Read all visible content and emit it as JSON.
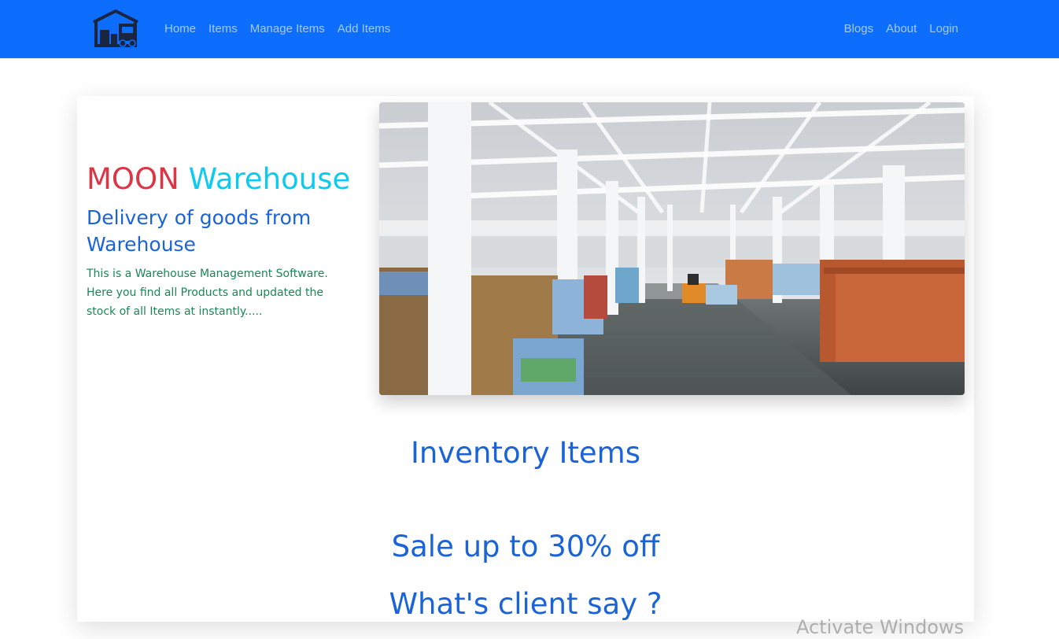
{
  "colors": {
    "navbar": "#0d6efd",
    "nav_link": "rgba(255,255,255,0.62)",
    "title_moon": "#dc3545",
    "title_warehouse": "#0dcaf0",
    "heading_blue": "#1a63d9",
    "description_green": "#198754"
  },
  "navbar": {
    "logo_icon": "warehouse-truck-icon",
    "left_links": [
      "Home",
      "Items",
      "Manage Items",
      "Add Items"
    ],
    "right_links": [
      "Blogs",
      "About",
      "Login"
    ]
  },
  "hero": {
    "title_part1": "MOON",
    "title_part2": "Warehouse",
    "subtitle": "Delivery of goods from Warehouse",
    "description": "This is a Warehouse Management Software. Here you find all Products and updated the stock of all Items at instantly....."
  },
  "sections": {
    "inventory_title": "Inventory Items",
    "sale_title": "Sale up to 30% off",
    "clients_title": "What's client say ?"
  },
  "os_overlay": {
    "watermark": "Activate Windows"
  }
}
